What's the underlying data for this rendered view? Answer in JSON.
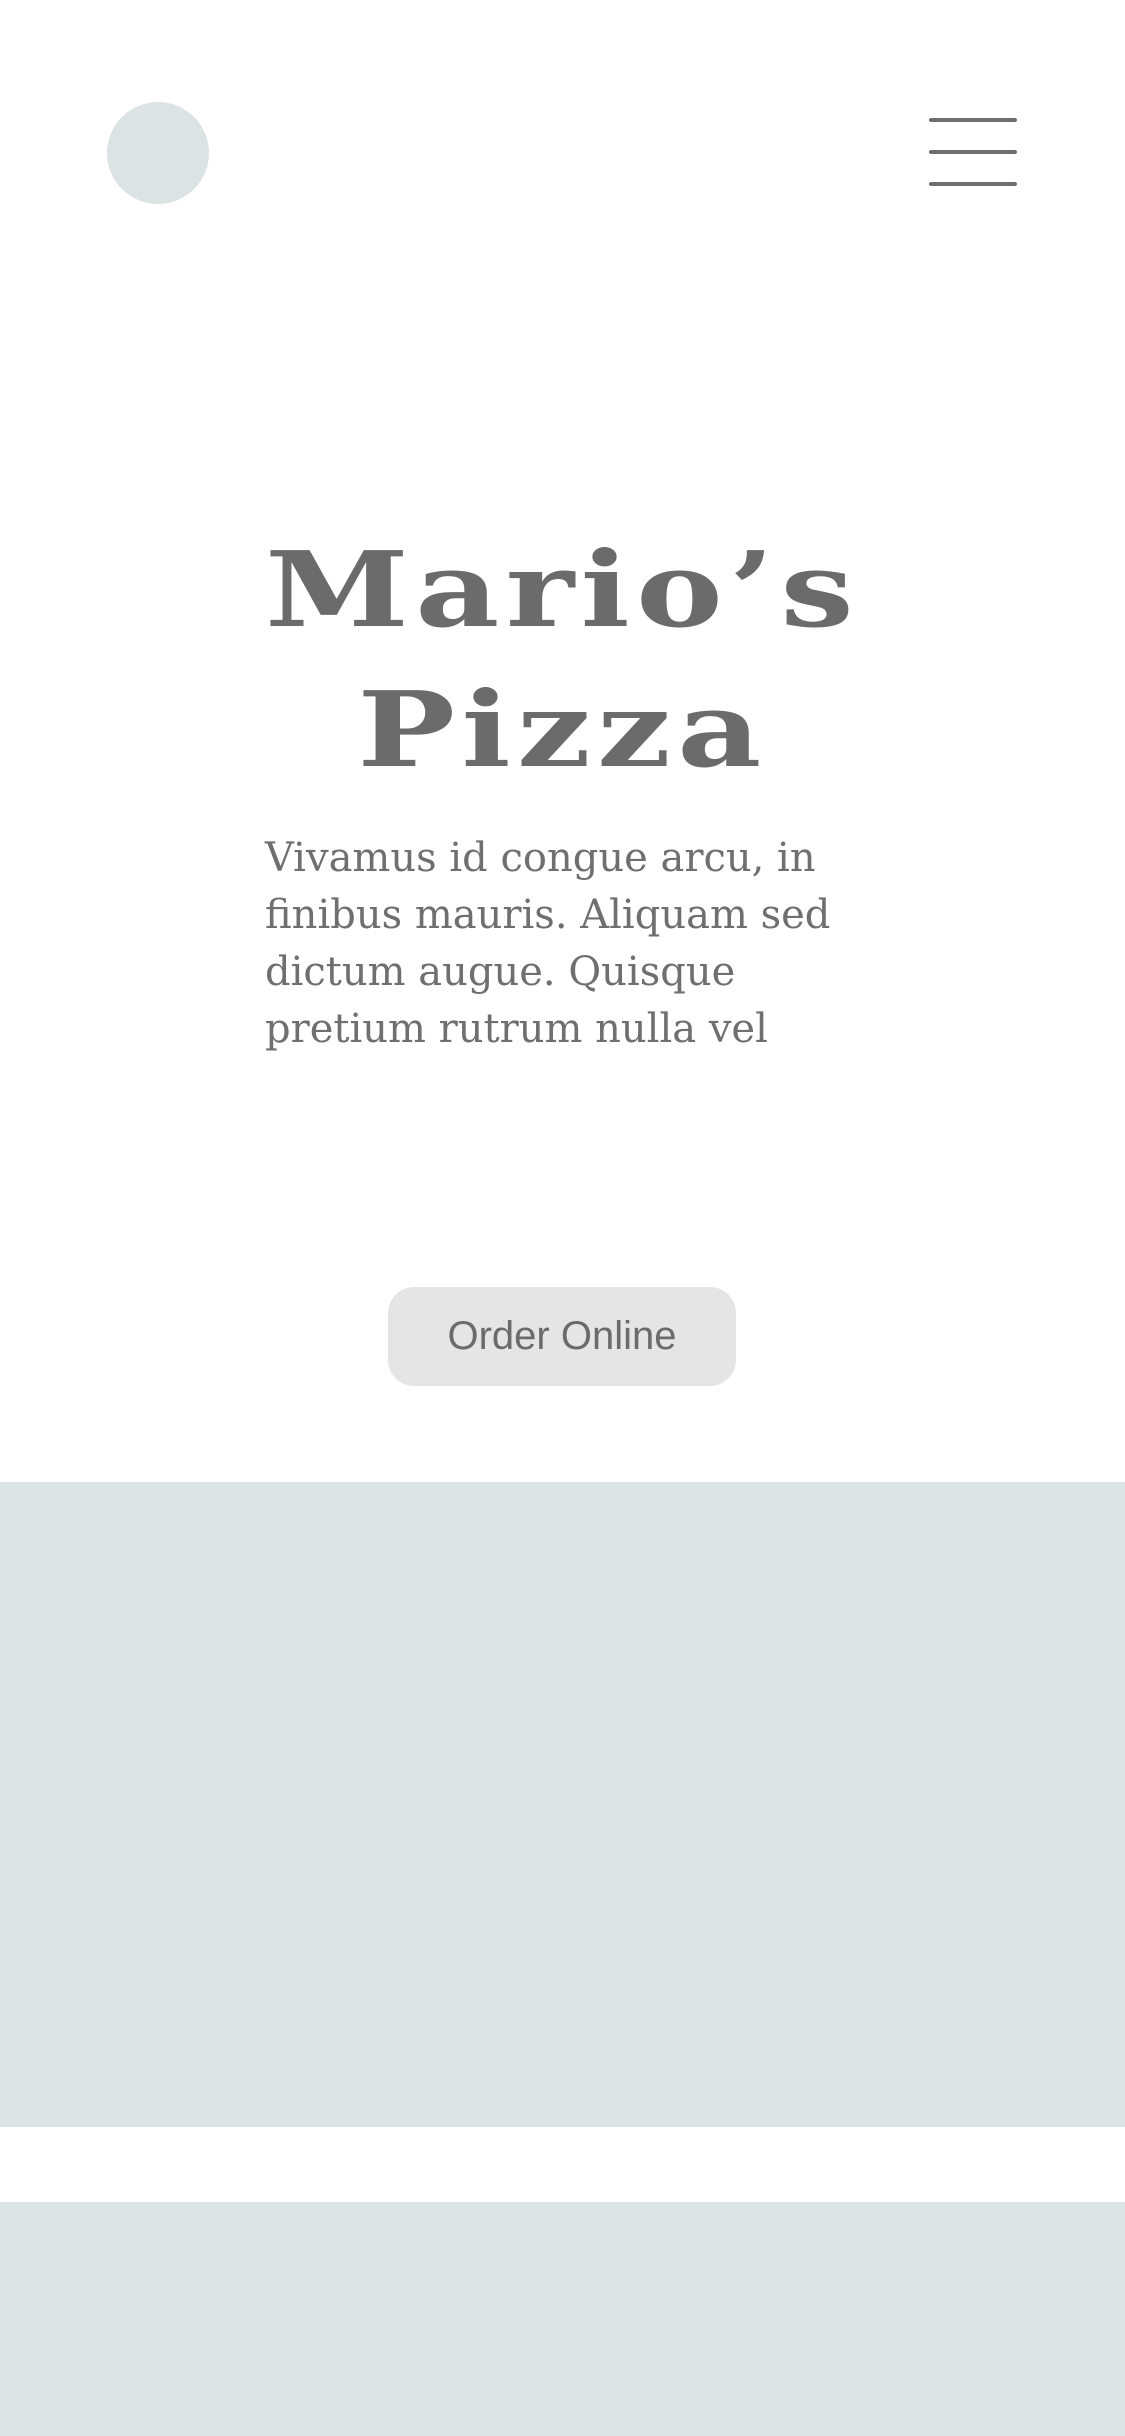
{
  "header": {
    "logo_icon": "logo-placeholder-circle",
    "menu_icon": "hamburger-menu-icon"
  },
  "hero": {
    "title_line_1": "Mario’s",
    "title_line_2": "Pizza",
    "description": "Vivamus id congue arcu, in finibus mauris. Aliquam sed dictum augue. Quisque pretium rutrum nulla vel",
    "cta_label": "Order Online"
  },
  "colors": {
    "placeholder": "#dce3e5",
    "text": "#6b6b6b",
    "button_bg": "#e5e5e5",
    "background": "#ffffff"
  }
}
